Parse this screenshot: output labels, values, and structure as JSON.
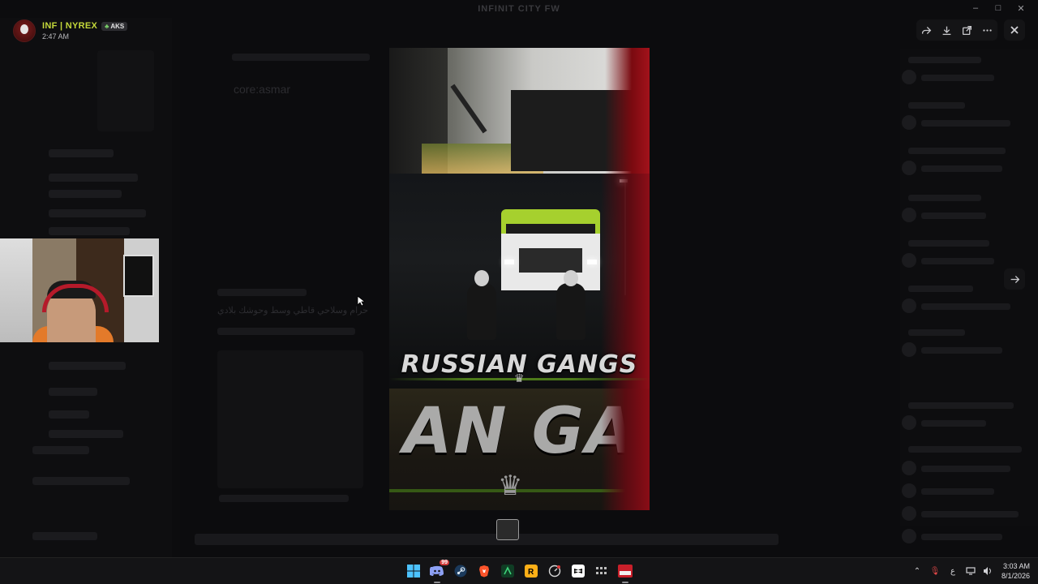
{
  "window": {
    "title": "INFINIT CITY FW"
  },
  "viewer": {
    "uploader_name": "INF | NYREX",
    "uploader_tag": "AKS",
    "timestamp": "2:47 AM",
    "toolbar_icons": [
      "forward-icon",
      "download-icon",
      "open-external-icon",
      "more-icon"
    ],
    "close_icon": "close-icon",
    "next_icon": "arrow-right-icon"
  },
  "background": {
    "faint_message": "core:asmar",
    "rtl_text": "حرام وسلاحي قاطي وسط وحوشك بلادي"
  },
  "poster": {
    "title": "RUSSIAN GANGS",
    "big_title": "AN GA"
  },
  "taskbar": {
    "discord_badge": "99",
    "clock_time": "3:03 AM",
    "clock_date": "8/1/2026",
    "ime_indicator": "ع"
  },
  "colors": {
    "uploader_name": "#c4d83a",
    "truck_green": "#a6d02e",
    "accent_red": "#a3121b"
  }
}
